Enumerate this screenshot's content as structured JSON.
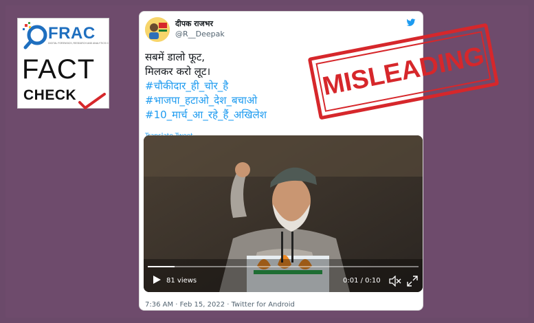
{
  "logo": {
    "brand": "FRAC",
    "tagline": "DIGITAL FORENSICS, RESEARCH AND ANALYTICS CENTRE",
    "line1": "FACT",
    "line2": "CHECK"
  },
  "stamp": {
    "label": "MISLEADING",
    "color": "#d6272b"
  },
  "tweet": {
    "author_name": "दीपक राजभर",
    "author_handle": "@R__Deepak",
    "lines": [
      "सबमें डालो फूट,",
      "मिलकर करो लूट।"
    ],
    "hashtags": [
      "#चौकीदार_ही_चोर_है",
      "#भाजपा_हटाओ_देश_बचाओ",
      "#10_मार्च_आ_रहे_हैं_अखिलेश"
    ],
    "translate_label": "Translate Tweet",
    "video": {
      "views": "81 views",
      "time": "0:01 / 0:10",
      "progress": 0.1
    },
    "meta": "7:36 AM · Feb 15, 2022 · Twitter for Android"
  },
  "colors": {
    "background": "#6e4b6c",
    "link": "#1d9bf0",
    "brand_blue": "#1f6fbf"
  }
}
